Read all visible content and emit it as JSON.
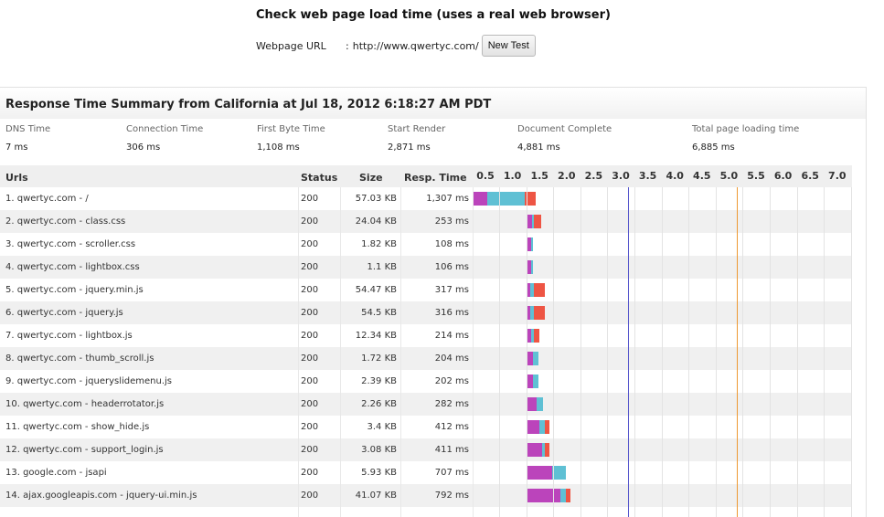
{
  "page": {
    "title": "Check web page load time (uses a real web browser)",
    "url_label": "Webpage URL",
    "url_sep": ":",
    "url_value": "http://www.qwertyc.com/",
    "new_test_label": "New Test"
  },
  "summary": {
    "title": "Response Time Summary from California at Jul 18, 2012 6:18:27 AM PDT",
    "metrics": [
      {
        "label": "DNS Time",
        "value": "7 ms"
      },
      {
        "label": "Connection Time",
        "value": "306 ms"
      },
      {
        "label": "First Byte Time",
        "value": "1,108 ms"
      },
      {
        "label": "Start Render",
        "value": "2,871 ms"
      },
      {
        "label": "Document Complete",
        "value": "4,881 ms"
      },
      {
        "label": "Total page loading time",
        "value": "6,885 ms"
      }
    ]
  },
  "table": {
    "headers": {
      "urls": "Urls",
      "status": "Status",
      "size": "Size",
      "resp": "Resp. Time"
    },
    "ticks": [
      "0.5",
      "1.0",
      "1.5",
      "2.0",
      "2.5",
      "3.0",
      "3.5",
      "4.0",
      "4.5",
      "5.0",
      "5.5",
      "6.0",
      "6.5",
      "7.0"
    ],
    "markers": [
      {
        "name": "start-render",
        "seconds": 2.871,
        "color": "#5555cc"
      },
      {
        "name": "document-complete",
        "seconds": 4.881,
        "color": "#ee9933"
      }
    ],
    "colors": {
      "dns": "#2ba2a8",
      "connect": "#ee8833",
      "ssl": "#ffffff",
      "first_byte": "#bb44bb",
      "download": "#5fc0d4",
      "content": "#ee5544"
    },
    "rows": [
      {
        "url": "1. qwertyc.com - /",
        "status": "200",
        "size": "57.03 KB",
        "resp": "1,307 ms",
        "segments": [
          [
            0.0,
            0.25,
            "first_byte"
          ],
          [
            0.25,
            0.95,
            "download"
          ],
          [
            0.95,
            1.15,
            "content"
          ]
        ]
      },
      {
        "url": "2. qwertyc.com - class.css",
        "status": "200",
        "size": "24.04 KB",
        "resp": "253 ms",
        "segments": [
          [
            1.0,
            1.08,
            "first_byte"
          ],
          [
            1.08,
            1.12,
            "download"
          ],
          [
            1.12,
            1.25,
            "content"
          ]
        ]
      },
      {
        "url": "3. qwertyc.com - scroller.css",
        "status": "200",
        "size": "1.82 KB",
        "resp": "108 ms",
        "segments": [
          [
            1.0,
            1.06,
            "first_byte"
          ],
          [
            1.06,
            1.1,
            "download"
          ]
        ]
      },
      {
        "url": "4. qwertyc.com - lightbox.css",
        "status": "200",
        "size": "1.1 KB",
        "resp": "106 ms",
        "segments": [
          [
            1.0,
            1.06,
            "first_byte"
          ],
          [
            1.06,
            1.1,
            "download"
          ]
        ]
      },
      {
        "url": "5. qwertyc.com - jquery.min.js",
        "status": "200",
        "size": "54.47 KB",
        "resp": "317 ms",
        "segments": [
          [
            1.0,
            1.05,
            "first_byte"
          ],
          [
            1.05,
            1.12,
            "download"
          ],
          [
            1.12,
            1.31,
            "content"
          ]
        ]
      },
      {
        "url": "6. qwertyc.com - jquery.js",
        "status": "200",
        "size": "54.5 KB",
        "resp": "316 ms",
        "segments": [
          [
            1.0,
            1.05,
            "first_byte"
          ],
          [
            1.05,
            1.12,
            "download"
          ],
          [
            1.12,
            1.31,
            "content"
          ]
        ]
      },
      {
        "url": "7. qwertyc.com - lightbox.js",
        "status": "200",
        "size": "12.34 KB",
        "resp": "214 ms",
        "segments": [
          [
            1.0,
            1.07,
            "first_byte"
          ],
          [
            1.07,
            1.11,
            "download"
          ],
          [
            1.11,
            1.21,
            "content"
          ]
        ]
      },
      {
        "url": "8. qwertyc.com - thumb_scroll.js",
        "status": "200",
        "size": "1.72 KB",
        "resp": "204 ms",
        "segments": [
          [
            1.0,
            1.1,
            "first_byte"
          ],
          [
            1.1,
            1.2,
            "download"
          ]
        ]
      },
      {
        "url": "9. qwertyc.com - jqueryslidemenu.js",
        "status": "200",
        "size": "2.39 KB",
        "resp": "202 ms",
        "segments": [
          [
            1.0,
            1.1,
            "first_byte"
          ],
          [
            1.1,
            1.2,
            "download"
          ]
        ]
      },
      {
        "url": "10. qwertyc.com - headerrotator.js",
        "status": "200",
        "size": "2.26 KB",
        "resp": "282 ms",
        "segments": [
          [
            1.0,
            1.17,
            "first_byte"
          ],
          [
            1.17,
            1.28,
            "download"
          ]
        ]
      },
      {
        "url": "11. qwertyc.com - show_hide.js",
        "status": "200",
        "size": "3.4 KB",
        "resp": "412 ms",
        "segments": [
          [
            1.0,
            1.22,
            "first_byte"
          ],
          [
            1.22,
            1.32,
            "download"
          ],
          [
            1.32,
            1.41,
            "content"
          ]
        ]
      },
      {
        "url": "12. qwertyc.com - support_login.js",
        "status": "200",
        "size": "3.08 KB",
        "resp": "411 ms",
        "segments": [
          [
            1.0,
            1.26,
            "first_byte"
          ],
          [
            1.26,
            1.32,
            "download"
          ],
          [
            1.32,
            1.41,
            "content"
          ]
        ]
      },
      {
        "url": "13. google.com - jsapi",
        "status": "200",
        "size": "5.93 KB",
        "resp": "707 ms",
        "segments": [
          [
            1.0,
            1.45,
            "first_byte"
          ],
          [
            1.45,
            1.7,
            "download"
          ]
        ]
      },
      {
        "url": "14. ajax.googleapis.com - jquery-ui.min.js",
        "status": "200",
        "size": "41.07 KB",
        "resp": "792 ms",
        "segments": [
          [
            1.0,
            1.6,
            "first_byte"
          ],
          [
            1.6,
            1.7,
            "download"
          ],
          [
            1.7,
            1.79,
            "content"
          ]
        ]
      }
    ]
  }
}
